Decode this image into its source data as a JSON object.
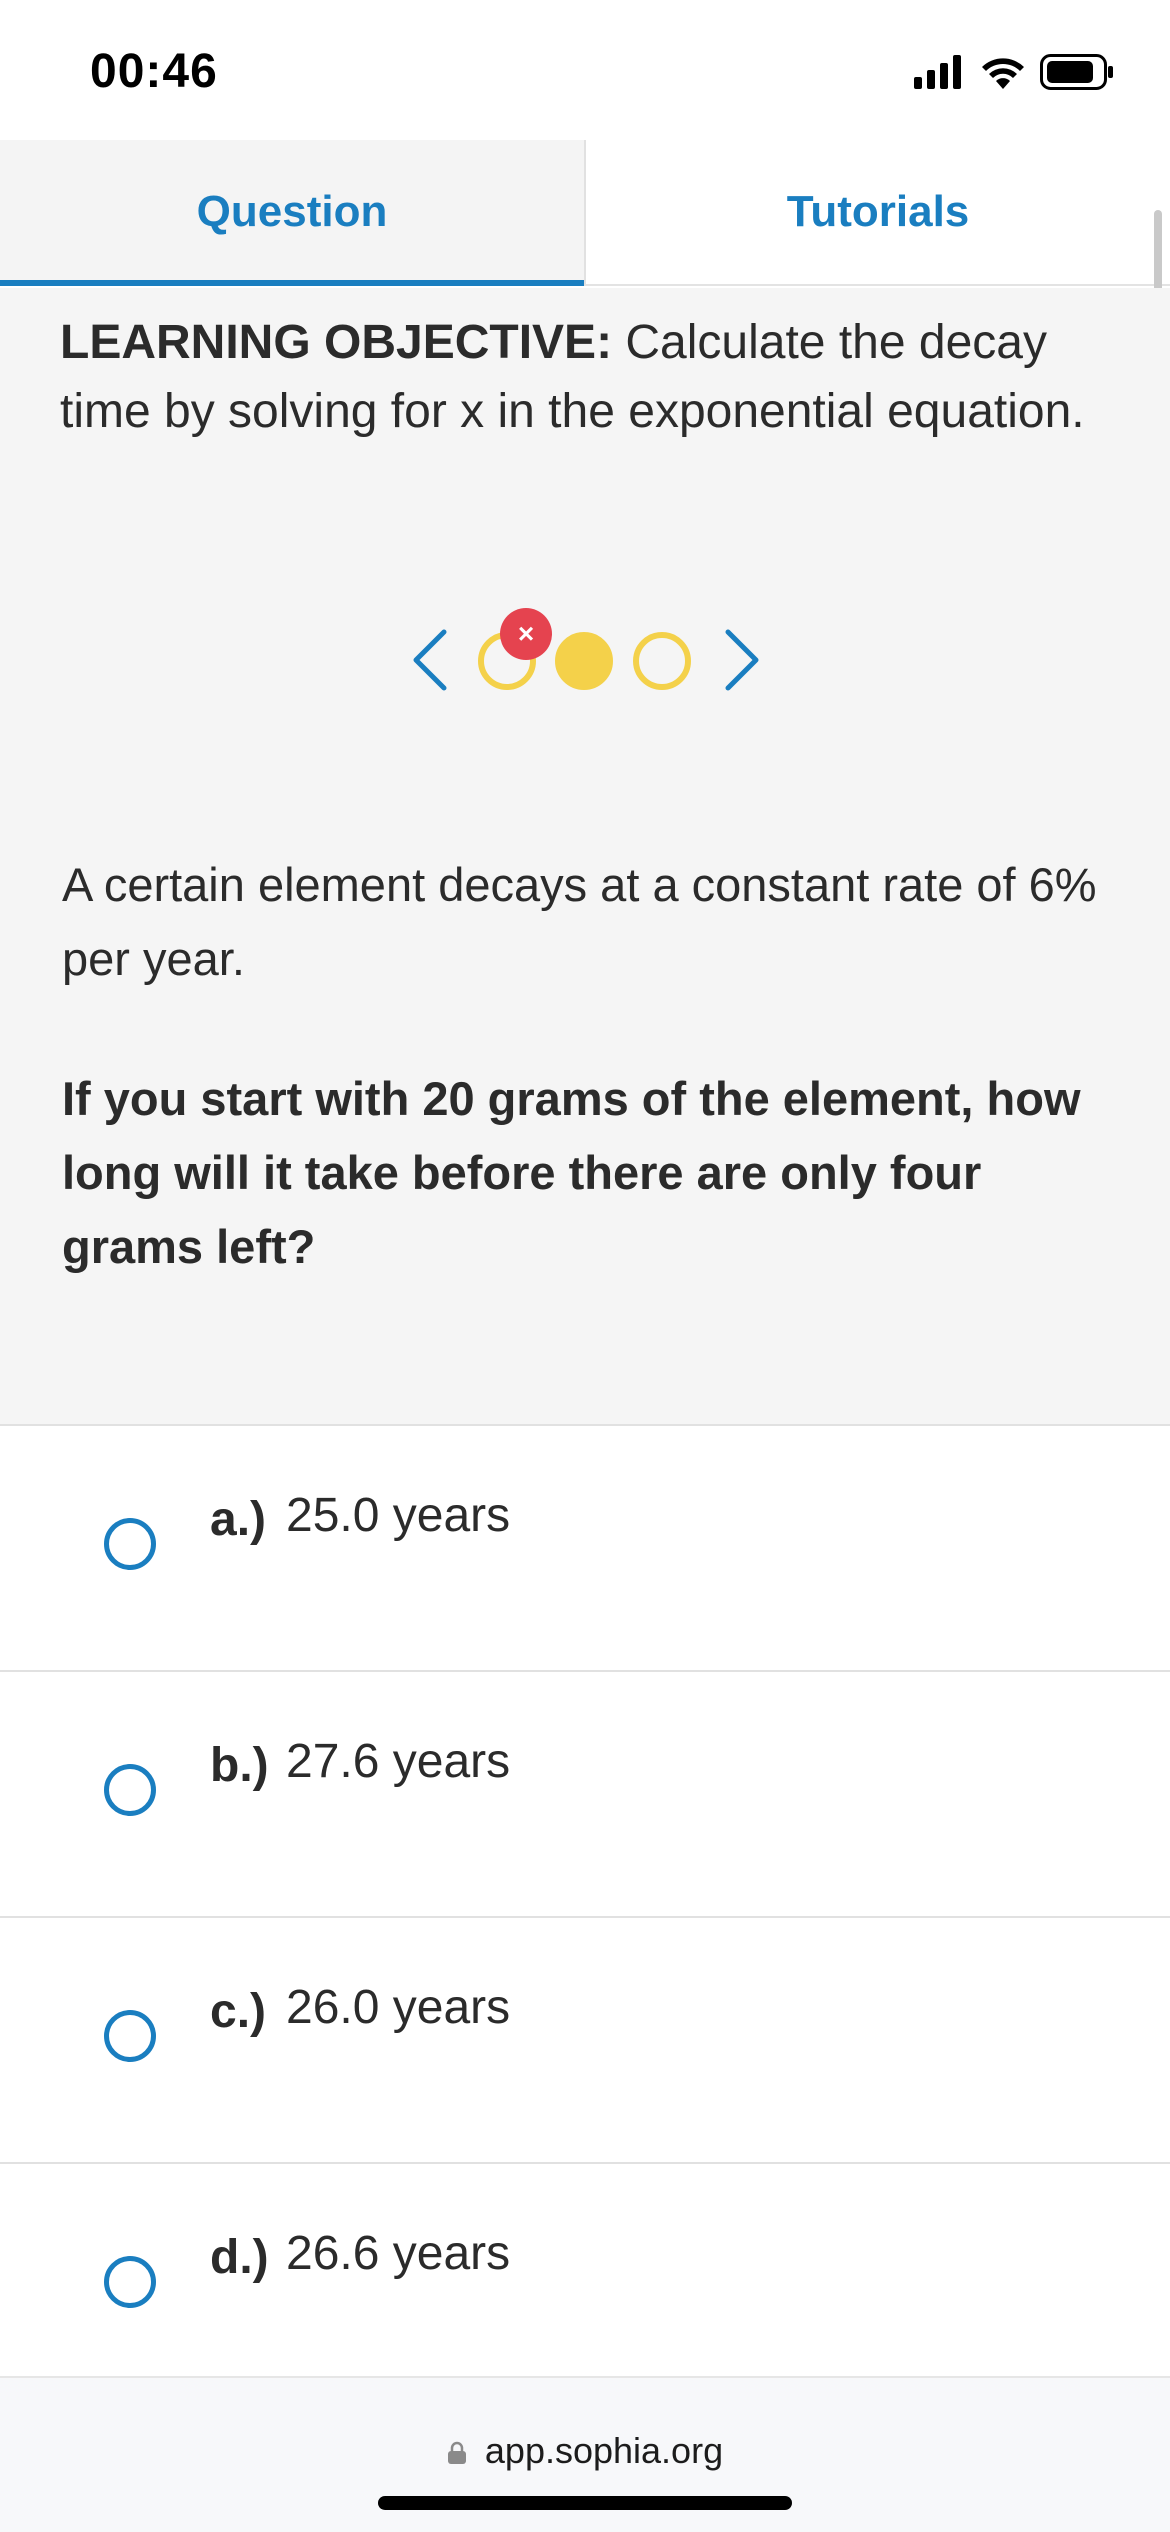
{
  "status": {
    "time": "00:46"
  },
  "tabs": [
    {
      "label": "Question",
      "active": true
    },
    {
      "label": "Tutorials",
      "active": false
    }
  ],
  "objective": {
    "heading": "LEARNING OBJECTIVE:",
    "text": " Calculate the decay time by solving for x in the exponential equation."
  },
  "pager": {
    "badge": "×",
    "dots": [
      "empty",
      "filled",
      "empty"
    ]
  },
  "question": {
    "prompt": "A certain element decays at a constant rate of 6% per year.",
    "ask": "If you start with 20 grams of the element, how long will it take before there are only four grams left?"
  },
  "options": [
    {
      "letter": "a.)",
      "text": "25.0 years"
    },
    {
      "letter": "b.)",
      "text": "27.6 years"
    },
    {
      "letter": "c.)",
      "text": "26.0 years"
    },
    {
      "letter": "d.)",
      "text": "26.6 years"
    }
  ],
  "browser": {
    "url": "app.sophia.org"
  },
  "colors": {
    "accent": "#1a7ec0",
    "dot": "#f4d14a",
    "badge": "#e5434f"
  }
}
